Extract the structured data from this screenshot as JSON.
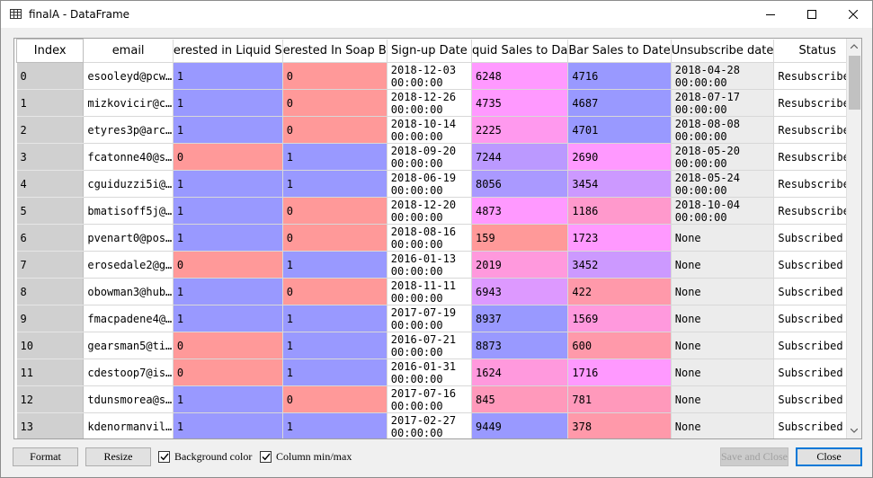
{
  "window": {
    "title": "finalA - DataFrame"
  },
  "table": {
    "index_header": "Index",
    "columns": [
      "email",
      "erested in Liquid S",
      "erested In Soap B",
      "Sign-up Date",
      "quid Sales to Da",
      "Bar Sales to Date",
      "Unsubscribe date",
      "Status"
    ],
    "rows": [
      [
        "0",
        "esooleyd@pcw…",
        "1",
        "0",
        "2018-12-03|00:00:00",
        "6248",
        "4716",
        "2018-04-28|00:00:00",
        "Resubscribed"
      ],
      [
        "1",
        "mizkovicir@c…",
        "1",
        "0",
        "2018-12-26|00:00:00",
        "4735",
        "4687",
        "2018-07-17|00:00:00",
        "Resubscribed"
      ],
      [
        "2",
        "etyres3p@arc…",
        "1",
        "0",
        "2018-10-14|00:00:00",
        "2225",
        "4701",
        "2018-08-08|00:00:00",
        "Resubscribed"
      ],
      [
        "3",
        "fcatonne40@s…",
        "0",
        "1",
        "2018-09-20|00:00:00",
        "7244",
        "2690",
        "2018-05-20|00:00:00",
        "Resubscribed"
      ],
      [
        "4",
        "cguiduzzi5i@…",
        "1",
        "1",
        "2018-06-19|00:00:00",
        "8056",
        "3454",
        "2018-05-24|00:00:00",
        "Resubscribed"
      ],
      [
        "5",
        "bmatisoff5j@…",
        "1",
        "0",
        "2018-12-20|00:00:00",
        "4873",
        "1186",
        "2018-10-04|00:00:00",
        "Resubscribed"
      ],
      [
        "6",
        "pvenart0@pos…",
        "1",
        "0",
        "2018-08-16|00:00:00",
        "159",
        "1723",
        "None",
        "Subscribed"
      ],
      [
        "7",
        "erosedale2@g…",
        "0",
        "1",
        "2016-01-13|00:00:00",
        "2019",
        "3452",
        "None",
        "Subscribed"
      ],
      [
        "8",
        "obowman3@hub…",
        "1",
        "0",
        "2018-11-11|00:00:00",
        "6943",
        "422",
        "None",
        "Subscribed"
      ],
      [
        "9",
        "fmacpadene4@…",
        "1",
        "1",
        "2017-07-19|00:00:00",
        "8937",
        "1569",
        "None",
        "Subscribed"
      ],
      [
        "10",
        "gearsman5@ti…",
        "0",
        "1",
        "2016-07-21|00:00:00",
        "8873",
        "600",
        "None",
        "Subscribed"
      ],
      [
        "11",
        "cdestoop7@is…",
        "0",
        "1",
        "2016-01-31|00:00:00",
        "1624",
        "1716",
        "None",
        "Subscribed"
      ],
      [
        "12",
        "tdunsmorea@s…",
        "1",
        "0",
        "2017-07-16|00:00:00",
        "845",
        "781",
        "None",
        "Subscribed"
      ],
      [
        "13",
        "kdenormanvil…",
        "1",
        "1",
        "2017-02-27|00:00:00",
        "9449",
        "378",
        "None",
        "Subscribed"
      ]
    ]
  },
  "colors": {
    "flag_one": "#9999ff",
    "flag_zero": "#ff9999",
    "liquid": [
      "#ff99ff",
      "#ff99ff",
      "#ff99ee",
      "#bb99ff",
      "#aa99ff",
      "#ff99ff",
      "#ff9999",
      "#ff99dd",
      "#dd99ff",
      "#9999ff",
      "#9999ff",
      "#ff99dd",
      "#ff99bb",
      "#9999ff"
    ],
    "bar": [
      "#9999ff",
      "#9999ff",
      "#9999ff",
      "#ff99ff",
      "#cc99ff",
      "#ff99cc",
      "#ff99ff",
      "#cc99ff",
      "#ff99aa",
      "#ff99dd",
      "#ff99aa",
      "#ff99ff",
      "#ff99bb",
      "#ff99aa"
    ]
  },
  "buttons": {
    "format": "Format",
    "resize": "Resize",
    "save_close": "Save and Close",
    "close": "Close"
  },
  "checkboxes": {
    "background_color": "Background color",
    "column_minmax": "Column min/max"
  }
}
